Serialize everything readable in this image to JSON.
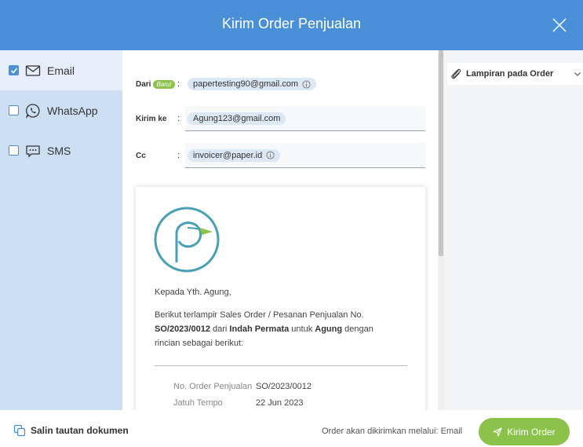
{
  "header": {
    "title": "Kirim Order Penjualan"
  },
  "sidebar": {
    "channels": [
      {
        "label": "Email",
        "checked": true
      },
      {
        "label": "WhatsApp",
        "checked": false
      },
      {
        "label": "SMS",
        "checked": false
      }
    ]
  },
  "form": {
    "from_label": "Dari",
    "new_badge": "Baru!",
    "from_value": "papertesting90@gmail.com",
    "to_label": "Kirim ke",
    "to_value": "Agung123@gmail.com",
    "cc_label": "Cc",
    "cc_value": "invoicer@paper.id",
    "colon": ":"
  },
  "preview": {
    "greeting": "Kepada Yth. Agung,",
    "body_1": "Berikut terlampir Sales Order / Pesanan Penjualan No.",
    "order_no": "SO/2023/0012",
    "body_2": " dari ",
    "company": "Indah Permata",
    "body_3": " untuk ",
    "customer": "Agung",
    "body_4": " dengan rincian sebagai berikut:",
    "details": [
      {
        "key": "No. Order Penjualan",
        "value": "SO/2023/0012"
      },
      {
        "key": "Jatuh Tempo",
        "value": "22 Jun 2023"
      }
    ]
  },
  "attachments": {
    "label": "Lampiran pada Order"
  },
  "footer": {
    "copy_link": "Salin tautan dokumen",
    "sent_via": "Order akan dikirimkan melalui: Email",
    "send_button": "Kirim Order"
  },
  "colors": {
    "primary": "#4a90d9",
    "accent": "#8bc34a",
    "sidebar": "#cde0f3"
  }
}
